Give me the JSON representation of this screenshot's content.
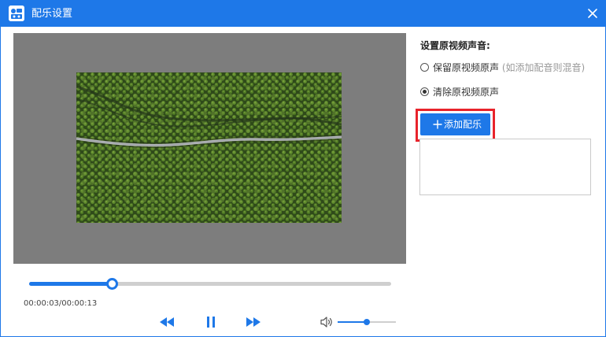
{
  "window": {
    "title": "配乐设置",
    "accent_color": "#1e78e8",
    "app_icon": "app-logo-icon",
    "close_icon": "close-icon"
  },
  "player": {
    "current_time": "00:00:03",
    "total_time": "00:00:13",
    "time_display": "00:00:03/00:00:13",
    "progress": 0.23,
    "volume": 0.5,
    "controls": [
      "rewind-icon",
      "pause-icon",
      "fast-forward-icon",
      "volume-icon"
    ]
  },
  "audio_settings": {
    "heading": "设置原视频声音:",
    "options": [
      {
        "label": "保留原视频原声",
        "hint": "(如添加配音则混音)",
        "selected": false
      },
      {
        "label": "清除原视频原声",
        "hint": "",
        "selected": true
      }
    ],
    "add_music_label": "添加配乐",
    "highlight_color": "#e8232b"
  }
}
